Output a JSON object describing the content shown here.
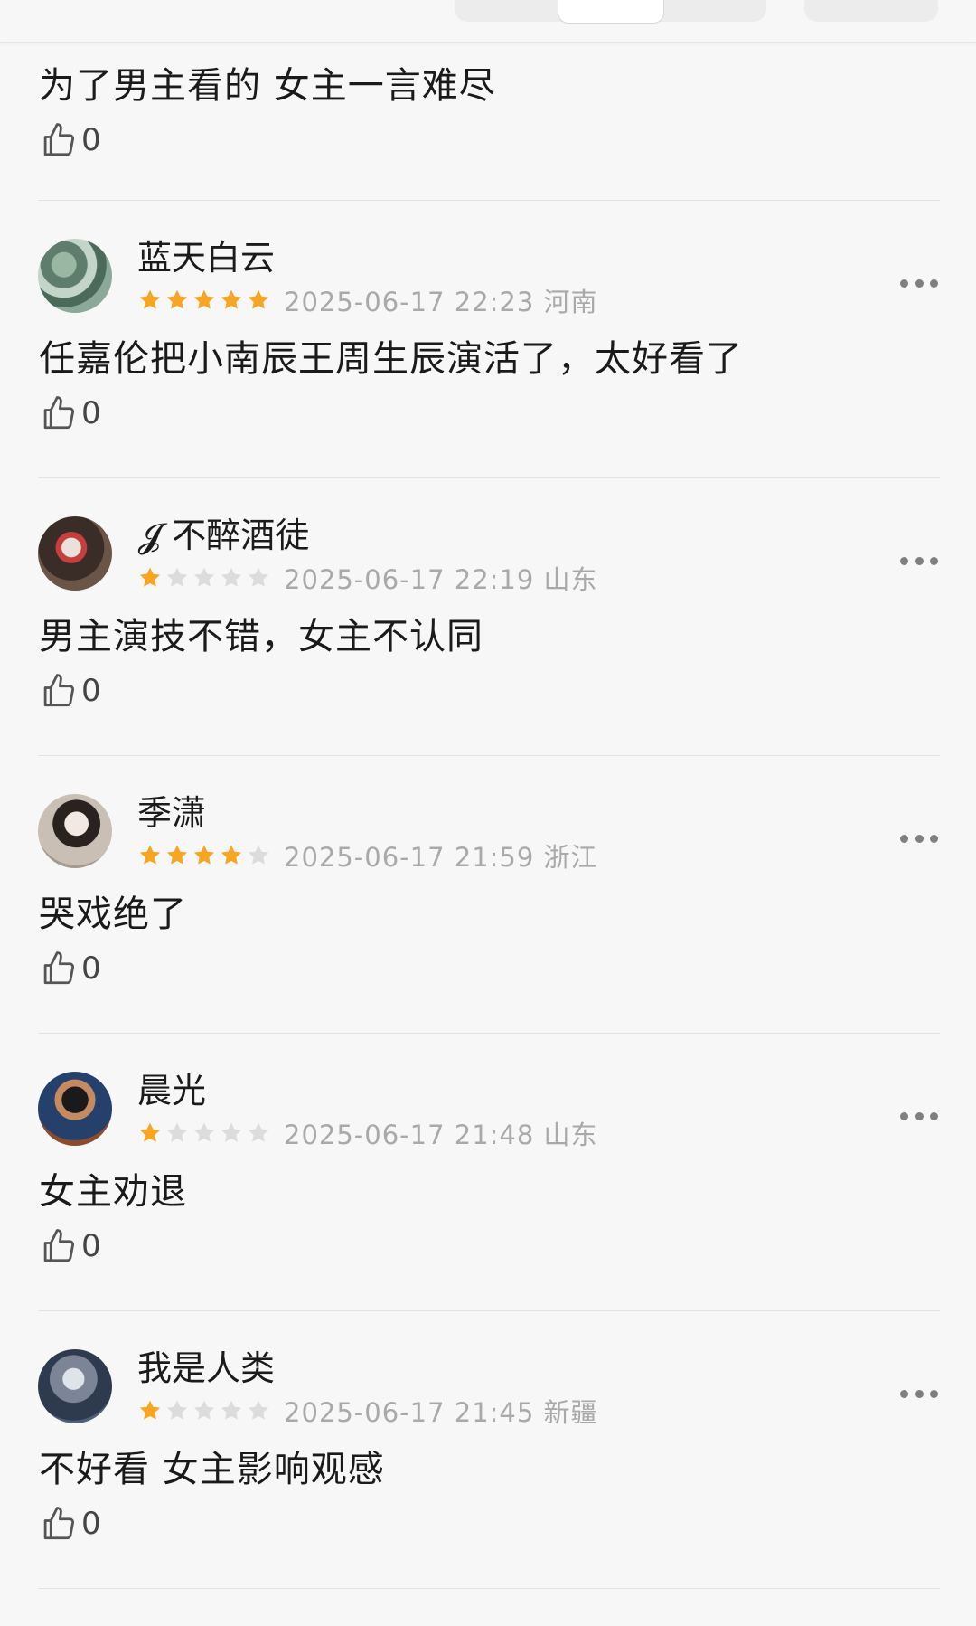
{
  "header": {
    "left_label": "",
    "tabs": [
      "",
      "",
      ""
    ],
    "right_button": ""
  },
  "colors": {
    "star_filled": "#f6a623",
    "star_empty": "#dcdcdc",
    "meta_text": "#a9a9a9"
  },
  "first_comment": {
    "text": "为了男主看的  女主一言难尽",
    "likes": "0"
  },
  "comments": [
    {
      "username": "蓝天白云",
      "rating": 5,
      "meta": "2025-06-17 22:23 河南",
      "text": "任嘉伦把小南辰王周生辰演活了，太好看了",
      "likes": "0"
    },
    {
      "username": "𝓙 不醉酒徒",
      "rating": 1,
      "meta": "2025-06-17 22:19 山东",
      "text": "男主演技不错，女主不认同",
      "likes": "0"
    },
    {
      "username": "季潇",
      "rating": 4,
      "meta": "2025-06-17 21:59 浙江",
      "text": "哭戏绝了",
      "likes": "0"
    },
    {
      "username": "晨光",
      "rating": 1,
      "meta": "2025-06-17 21:48 山东",
      "text": "女主劝退",
      "likes": "0"
    },
    {
      "username": "我是人类",
      "rating": 1,
      "meta": "2025-06-17 21:45 新疆",
      "text": "不好看  女主影响观感",
      "likes": "0"
    }
  ],
  "icons": {
    "like": "thumbs-up-icon",
    "more": "more-dots-icon",
    "star": "star-icon"
  }
}
